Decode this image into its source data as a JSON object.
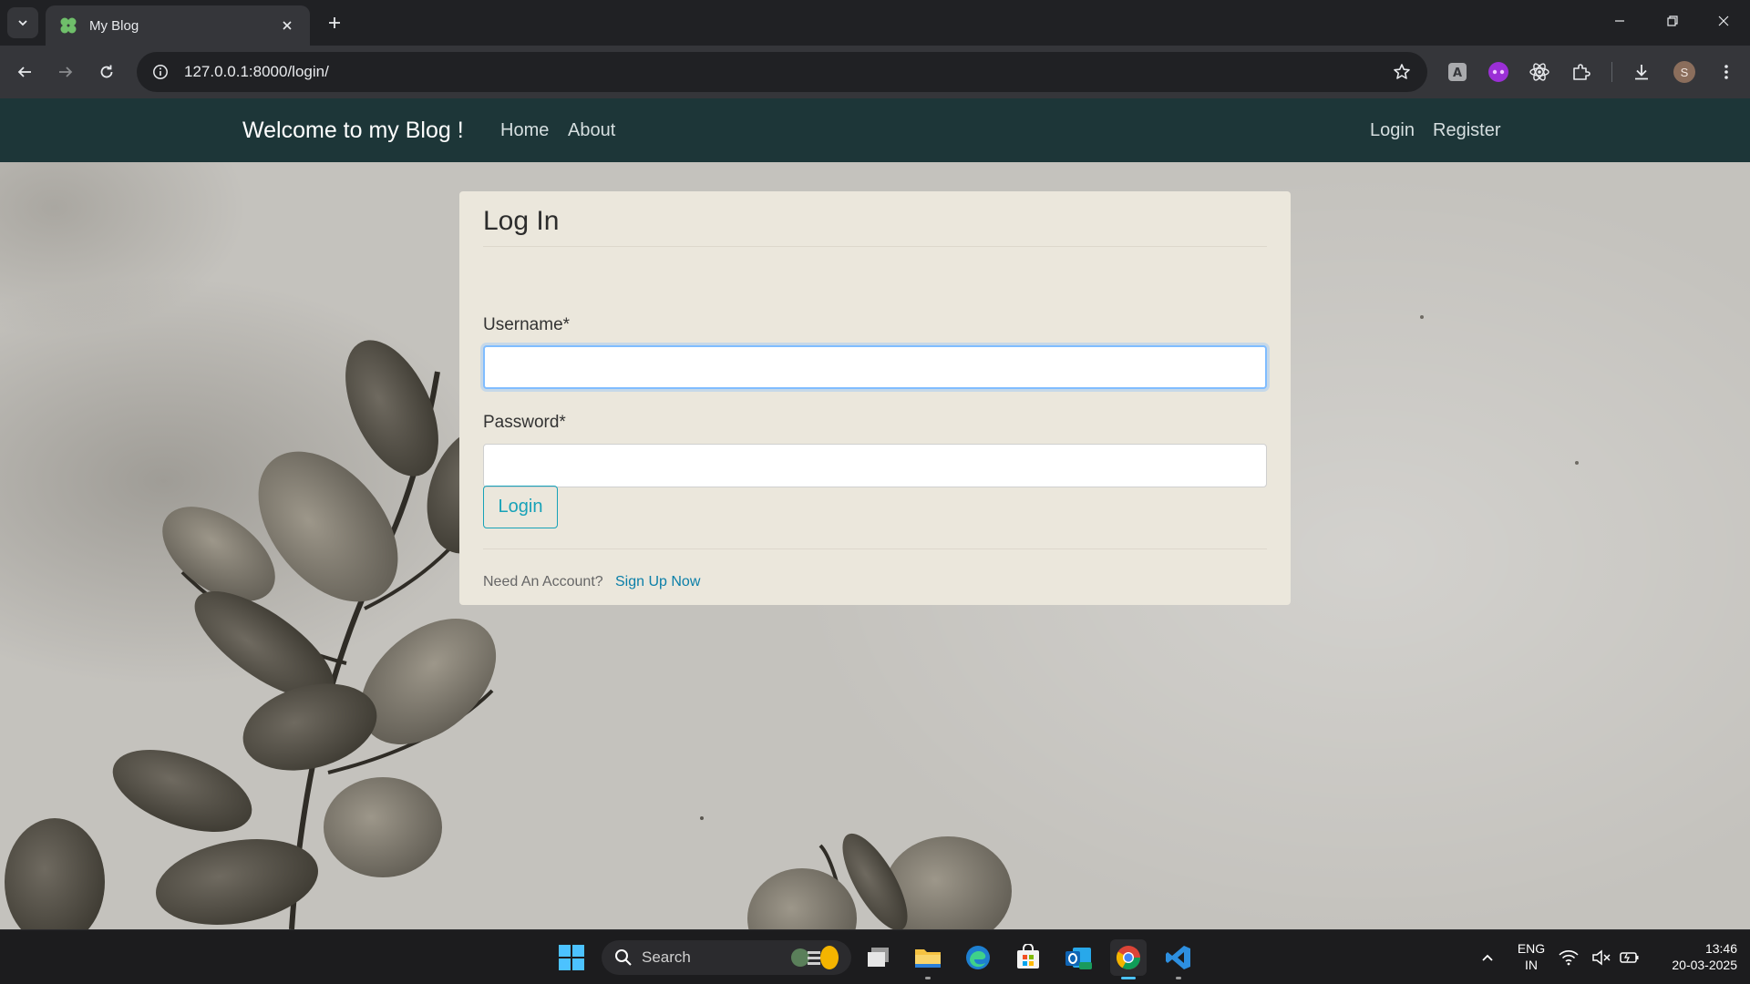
{
  "browser": {
    "tab_title": "My Blog",
    "url": "127.0.0.1:8000/login/",
    "profile_initial": "S"
  },
  "navbar": {
    "brand": "Welcome to my Blog !",
    "links": [
      "Home",
      "About"
    ],
    "right_links": [
      "Login",
      "Register"
    ]
  },
  "login_card": {
    "title": "Log In",
    "username_label": "Username*",
    "username_value": "",
    "password_label": "Password*",
    "password_value": "",
    "submit_label": "Login",
    "footer_text": "Need An Account?",
    "footer_link": "Sign Up Now"
  },
  "taskbar": {
    "search_label": "Search",
    "lang_line1": "ENG",
    "lang_line2": "IN",
    "time": "13:46",
    "date": "20-03-2025"
  },
  "colors": {
    "navbar_bg": "#1d3638",
    "card_bg": "#ebe7dc",
    "button_accent": "#17a2b8",
    "link_accent": "#0b7fa8",
    "focus_ring": "#80bdff"
  },
  "icons": {
    "tab_favicon": "clover-icon",
    "omnibox_info": "info-icon",
    "bookmark": "star-icon",
    "extensions": [
      "extension-a-icon",
      "extension-purple-icon",
      "react-devtools-icon",
      "puzzle-icon"
    ],
    "toolbar_right": [
      "download-icon",
      "profile-avatar",
      "kebab-menu-icon"
    ],
    "taskbar_apps": [
      "windows-start-icon",
      "widgets-icon",
      "task-view-icon",
      "file-explorer-icon",
      "edge-icon",
      "store-icon",
      "outlook-icon",
      "chrome-icon",
      "vscode-icon"
    ]
  }
}
